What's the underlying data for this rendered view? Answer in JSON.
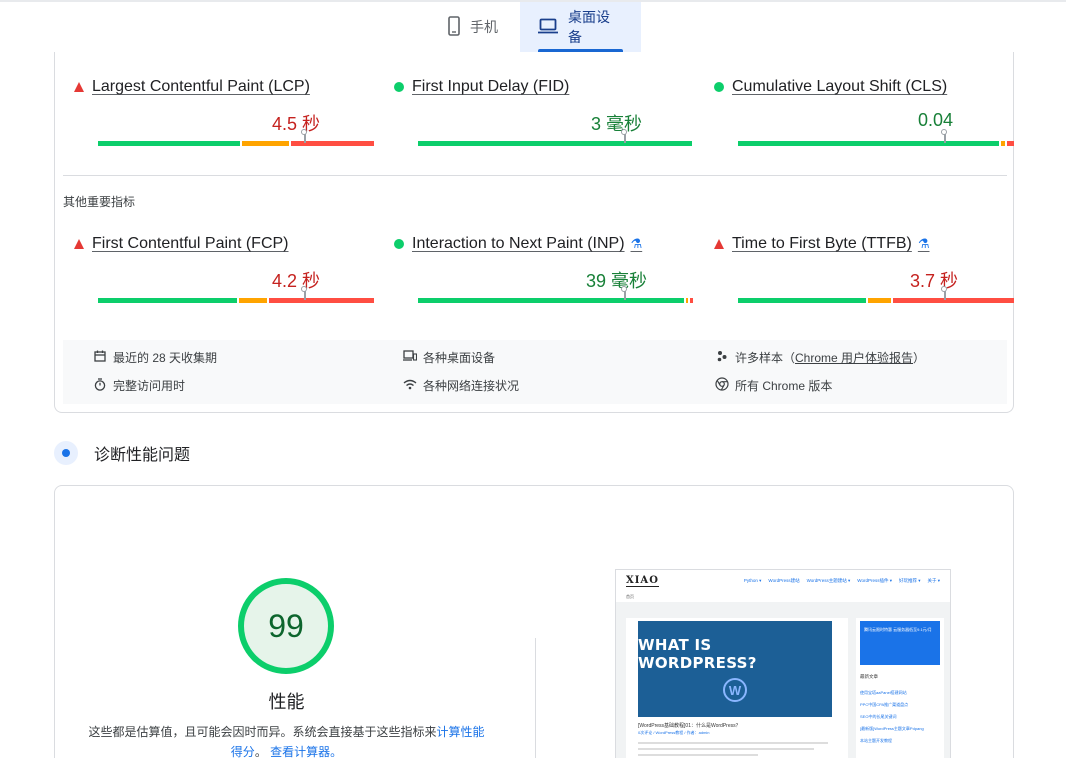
{
  "tabs": [
    {
      "label": "手机",
      "icon": "phone-icon",
      "selected": false
    },
    {
      "label": "桌面设备",
      "icon": "laptop-icon",
      "selected": true
    }
  ],
  "colors": {
    "good": "#0cce6b",
    "average": "#ffa400",
    "poor": "#ff4e42",
    "accent": "#1a73e8"
  },
  "core_metrics": [
    {
      "name": "Largest Contentful Paint (LCP)",
      "status": "poor",
      "value": "4.5 秒"
    },
    {
      "name": "First Input Delay (FID)",
      "status": "good",
      "value": "3 毫秒"
    },
    {
      "name": "Cumulative Layout Shift (CLS)",
      "status": "good",
      "value": "0.04"
    }
  ],
  "other_section_title": "其他重要指标",
  "other_metrics": [
    {
      "name": "First Contentful Paint (FCP)",
      "status": "poor",
      "value": "4.2 秒"
    },
    {
      "name": "Interaction to Next Paint (INP)",
      "status": "good",
      "value": "39 毫秒",
      "experimental": true
    },
    {
      "name": "Time to First Byte (TTFB)",
      "status": "poor",
      "value": "3.7 秒",
      "experimental": true
    }
  ],
  "info": {
    "period": "最近的 28 天收集期",
    "devices": "各种桌面设备",
    "samples_prefix": "许多样本（",
    "samples_link": "Chrome 用户体验报告",
    "samples_suffix": "）",
    "visit": "完整访问用时",
    "network": "各种网络连接状况",
    "versions": "所有 Chrome 版本"
  },
  "diagnose_title": "诊断性能问题",
  "performance": {
    "score": "99",
    "label": "性能",
    "note_prefix": "这些都是估算值，且可能会因时而异。系统会直接基于这些指标来",
    "note_link1": "计算性能得分",
    "note_mid": "。",
    "note_link2": "查看计算器。"
  },
  "thumbnail": {
    "logo": "XIAO",
    "nav": [
      "Python ▾",
      "WordPress建站",
      "WordPress主题建站 ▾",
      "WordPress插件 ▾",
      "好玩推荐 ▾",
      "关于 ▾"
    ],
    "crumb": "首页",
    "hero_title": "WHAT IS WORDPRESS?",
    "hero_logo": "W",
    "post_title": "[WordPress基础教程]01：什么是WordPress？",
    "post_meta": "0次评论 / WordPress教程 / 作者：admin",
    "ad_text": "腾讯云限时特惠 云服务器低至9.1元/月",
    "side_title": "最新文章",
    "side_links": [
      "使用宝塔aaPanel搭建网站",
      "PPC中国CPA推广渠道盘点",
      "SEO中的长尾关键词",
      "[最新版]WordPress主题文章Pdpang",
      "本站主题开发教程"
    ]
  }
}
